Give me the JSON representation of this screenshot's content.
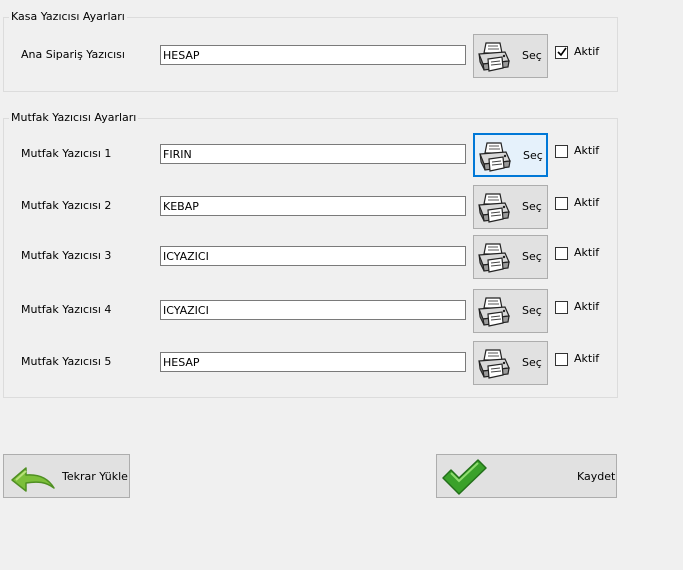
{
  "kasa": {
    "title": "Kasa Yazıcısı Ayarları",
    "row": {
      "label": "Ana Sipariş Yazıcısı",
      "value": "HESAP",
      "button": "Seç",
      "aktif_label": "Aktif",
      "aktif_checked": true
    }
  },
  "mutfak": {
    "title": "Mutfak Yazıcısı Ayarları",
    "rows": [
      {
        "label": "Mutfak Yazıcısı 1",
        "value": "FIRIN",
        "button": "Seç",
        "aktif_label": "Aktif",
        "aktif_checked": false
      },
      {
        "label": "Mutfak Yazıcısı 2",
        "value": "KEBAP",
        "button": "Seç",
        "aktif_label": "Aktif",
        "aktif_checked": false
      },
      {
        "label": "Mutfak Yazıcısı 3",
        "value": "ICYAZICI",
        "button": "Seç",
        "aktif_label": "Aktif",
        "aktif_checked": false
      },
      {
        "label": "Mutfak Yazıcısı 4",
        "value": "ICYAZICI",
        "button": "Seç",
        "aktif_label": "Aktif",
        "aktif_checked": false
      },
      {
        "label": "Mutfak Yazıcısı 5",
        "value": "HESAP",
        "button": "Seç",
        "aktif_label": "Aktif",
        "aktif_checked": false
      }
    ]
  },
  "footer": {
    "reload_label": "Tekrar Yükle",
    "save_label": "Kaydet"
  },
  "icons": {
    "printer": "printer-icon",
    "reload": "reload-arrow-icon",
    "save": "checkmark-icon"
  },
  "colors": {
    "background": "#f0f0f0",
    "focus": "#0078d7",
    "check_green": "#3aa12a",
    "reload_green": "#7cbf3a"
  }
}
